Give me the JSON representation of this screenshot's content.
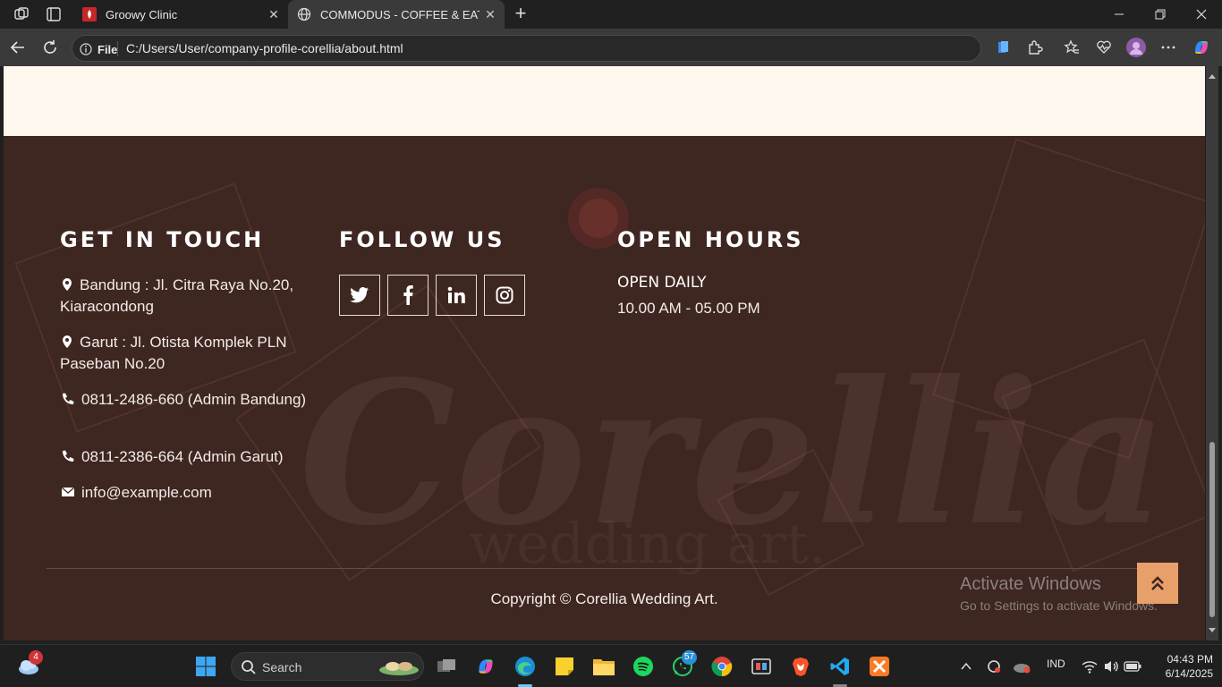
{
  "browser": {
    "tabs": [
      {
        "title": "Groowy Clinic"
      },
      {
        "title": "COMMODUS - COFFEE & EATERY"
      }
    ],
    "address": {
      "scheme_label": "File",
      "url": "C:/Users/User/company-profile-corellia/about.html"
    }
  },
  "footer": {
    "get_in_touch": {
      "title": "GET IN TOUCH",
      "items": [
        {
          "icon": "map-marker-icon",
          "text": "Bandung : Jl. Citra Raya No.20, Kiaracondong"
        },
        {
          "icon": "map-marker-icon",
          "text": "Garut : Jl. Otista Komplek PLN Paseban No.20"
        },
        {
          "icon": "phone-icon",
          "text": "0811-2486-660 (Admin Bandung)"
        },
        {
          "icon": "phone-icon",
          "text": "0811-2386-664 (Admin Garut)"
        },
        {
          "icon": "envelope-icon",
          "text": "info@example.com"
        }
      ]
    },
    "follow_us": {
      "title": "FOLLOW US",
      "links": [
        "twitter-icon",
        "facebook-icon",
        "linkedin-icon",
        "instagram-icon"
      ]
    },
    "open_hours": {
      "title": "OPEN HOURS",
      "label": "OPEN DAILY",
      "time": "10.00 AM - 05.00 PM"
    },
    "copyright": "Copyright © Corellia Wedding Art."
  },
  "watermark": {
    "line1": "Activate Windows",
    "line2": "Go to Settings to activate Windows."
  },
  "taskbar": {
    "search_label": "Search",
    "badges": {
      "weather": "4",
      "whatsapp": "57"
    },
    "tray": {
      "language": "IND"
    },
    "clock": {
      "time": "04:43 PM",
      "date": "6/14/2025"
    }
  },
  "colors": {
    "footer_bg": "#3e2621",
    "cream": "#fff8ef",
    "accent": "#e8a06a"
  }
}
